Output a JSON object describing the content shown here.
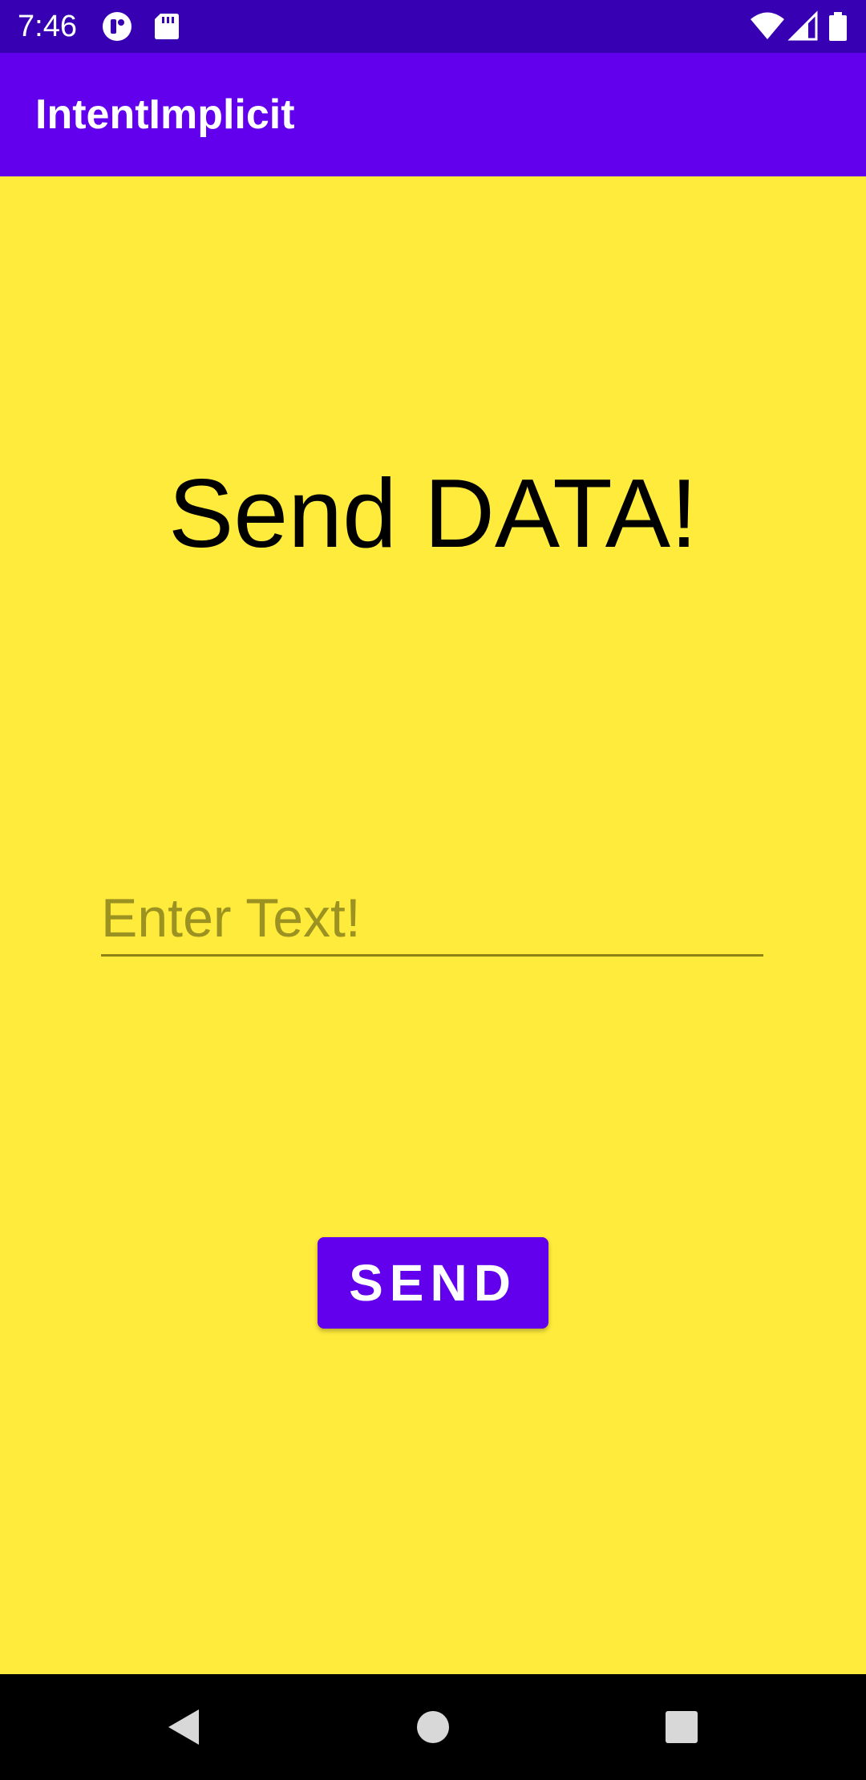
{
  "status_bar": {
    "time": "7:46",
    "left_icons": [
      "notification-icon",
      "sd-card-icon"
    ],
    "right_icons": [
      "wifi-icon",
      "signal-icon",
      "battery-icon"
    ]
  },
  "app_bar": {
    "title": "IntentImplicit",
    "color": "#6200EE"
  },
  "main": {
    "background": "#FFEB3B",
    "headline": "Send DATA!",
    "input": {
      "value": "",
      "placeholder": "Enter Text!"
    },
    "send_button_label": "SEND"
  },
  "nav_bar": {
    "buttons": [
      "back-icon",
      "home-icon",
      "recents-icon"
    ]
  }
}
